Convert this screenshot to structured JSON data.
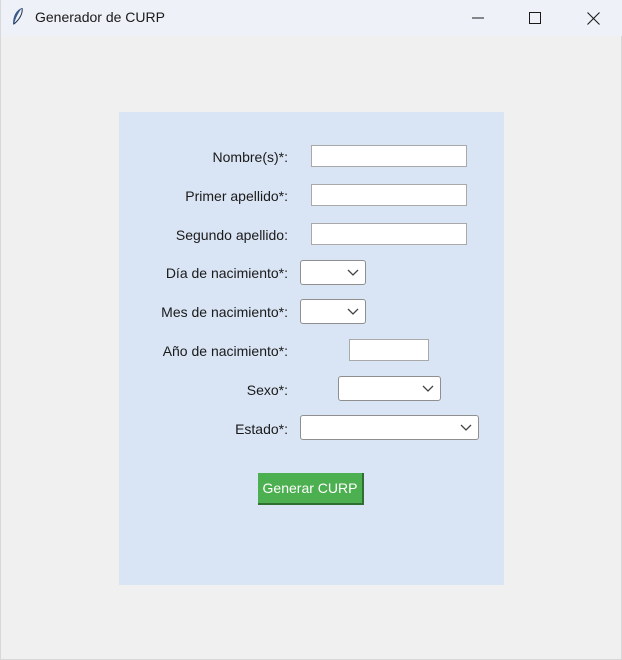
{
  "window": {
    "title": "Generador de CURP"
  },
  "form": {
    "nombre": {
      "label": "Nombre(s)*:",
      "value": ""
    },
    "primer_apellido": {
      "label": "Primer apellido*:",
      "value": ""
    },
    "segundo_apellido": {
      "label": "Segundo apellido:",
      "value": ""
    },
    "dia": {
      "label": "Día de nacimiento*:",
      "value": ""
    },
    "mes": {
      "label": "Mes de nacimiento*:",
      "value": ""
    },
    "anio": {
      "label": "Año de nacimiento*:",
      "value": ""
    },
    "sexo": {
      "label": "Sexo*:",
      "value": ""
    },
    "estado": {
      "label": "Estado*:",
      "value": ""
    }
  },
  "actions": {
    "generate_label": "Generar CURP"
  },
  "colors": {
    "panel_bg": "#d9e4f4",
    "button_bg": "#4caf50",
    "window_bg": "#f0f0f0"
  }
}
